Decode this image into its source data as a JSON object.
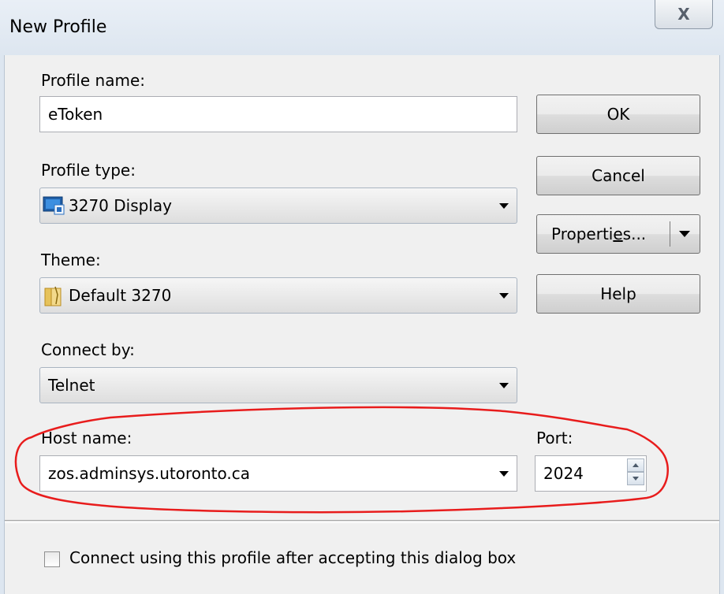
{
  "window": {
    "title": "New Profile",
    "close_label": "X"
  },
  "form": {
    "profile_name_label": "Profile name:",
    "profile_name_value": "eToken",
    "profile_type_label": "Profile type:",
    "profile_type_value": "3270 Display",
    "theme_label": "Theme:",
    "theme_value": "Default 3270",
    "connect_by_label": "Connect by:",
    "connect_by_value": "Telnet",
    "host_name_label": "Host name:",
    "host_name_value": "zos.adminsys.utoronto.ca",
    "port_label": "Port:",
    "port_value": "2024",
    "connect_checkbox_label": "Connect using this profile after accepting this dialog box",
    "connect_checkbox_checked": false
  },
  "buttons": {
    "ok": "OK",
    "cancel": "Cancel",
    "properties_prefix": "Properti",
    "properties_mnemonic": "e",
    "properties_suffix": "s...",
    "help": "Help"
  },
  "icons": {
    "profile_type": "3270-display-icon",
    "theme": "theme-folder-icon"
  },
  "annotation": {
    "color": "#e81c1c",
    "shape": "hand-drawn-ellipse"
  }
}
